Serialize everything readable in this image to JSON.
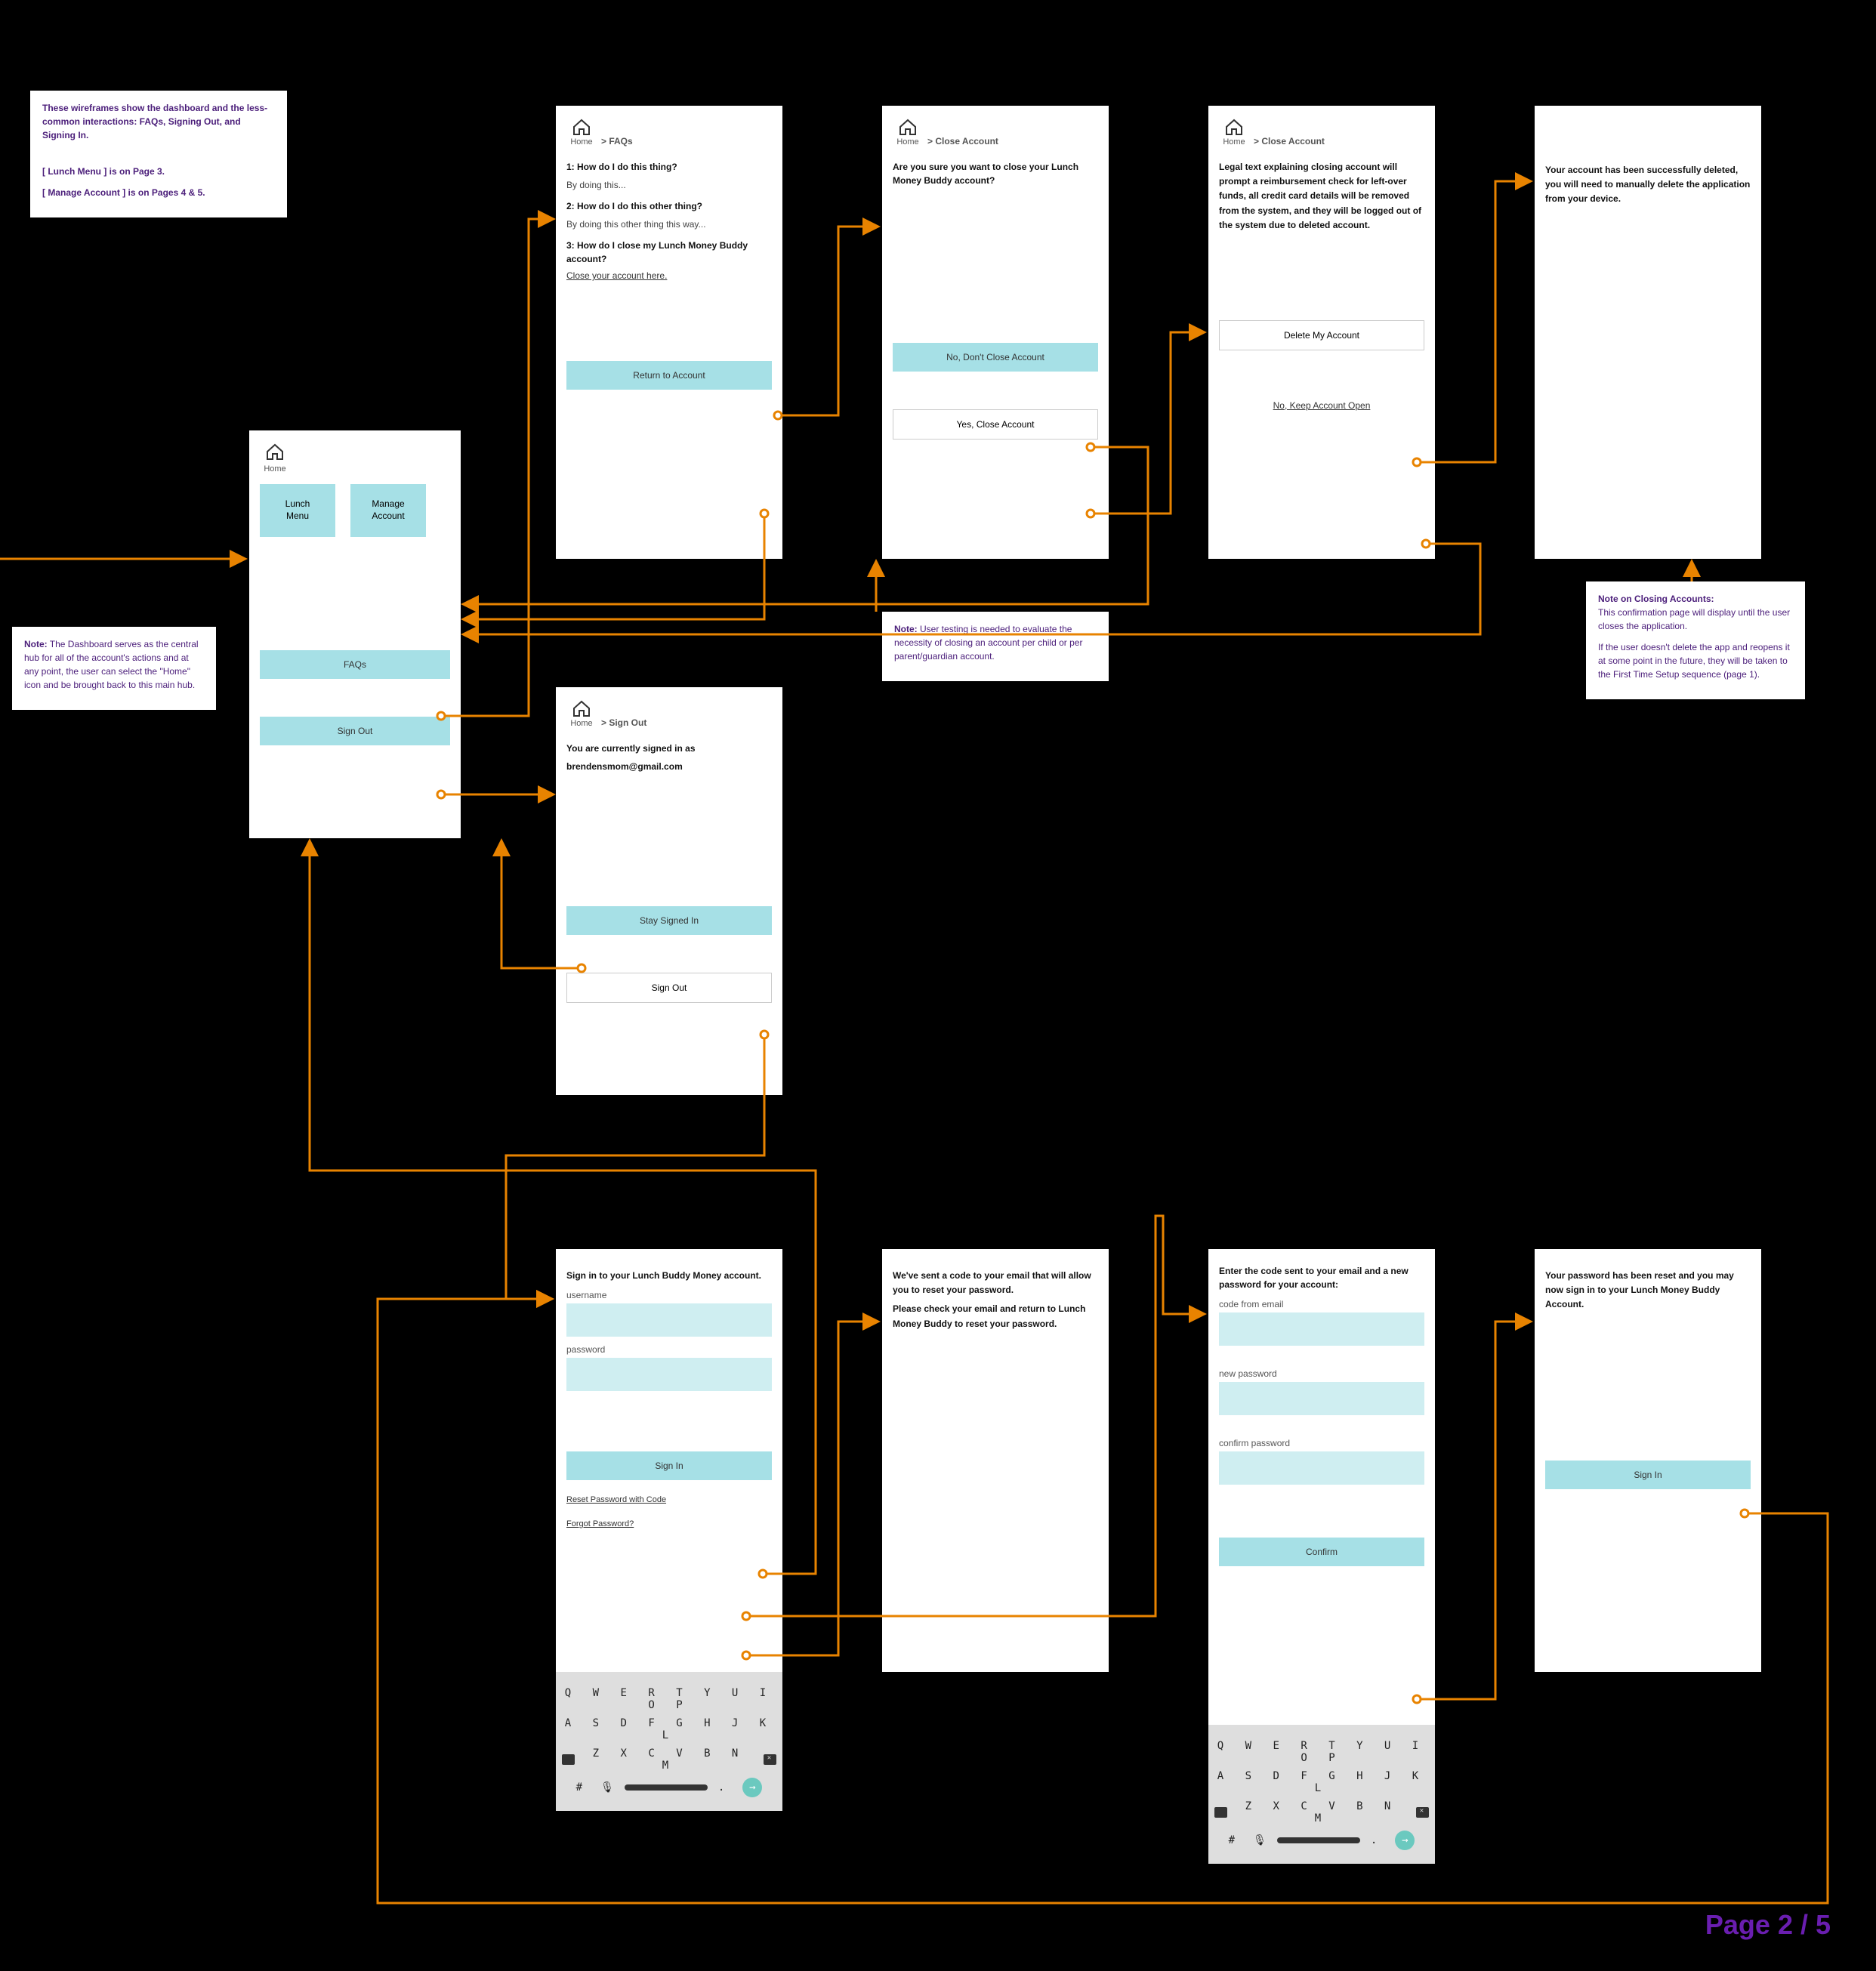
{
  "page_label": "Page 2 / 5",
  "note_intro": {
    "line1": "These wireframes show the dashboard and the less-common interactions: FAQs, Signing Out, and Signing In.",
    "line2": "[ Lunch Menu ] is on Page 3.",
    "line3": "[ Manage Account ] is on Pages 4 & 5."
  },
  "note_dashboard": {
    "label": "Note:",
    "text": "The Dashboard serves as the central hub for all of the account's actions and at any point, the user can select the \"Home\" icon and be brought back to this main hub."
  },
  "note_usertesting": {
    "label": "Note:",
    "text": "User testing is needed to evaluate the necessity of closing an account per child or per parent/guardian account."
  },
  "note_closing": {
    "title": "Note on Closing Accounts:",
    "p1": "This confirmation page will display until the user closes the application.",
    "p2": "If the user doesn't delete the app and reopens it at some point in the future, they will be taken to the First Time Setup sequence (page 1)."
  },
  "dashboard": {
    "home_label": "Home",
    "tile_lunch": "Lunch\nMenu",
    "tile_manage": "Manage\nAccount",
    "btn_faqs": "FAQs",
    "btn_signout": "Sign Out"
  },
  "faqs": {
    "crumb": "> FAQs",
    "q1": "1: How do I do this thing?",
    "a1": "By doing this...",
    "q2": "2: How do I do this other thing?",
    "a2": "By doing this other thing this way...",
    "q3": "3: How do I close my Lunch Money Buddy account?",
    "a3_link": "Close your account here.",
    "btn_return": "Return to Account"
  },
  "close_confirm": {
    "crumb": "> Close Account",
    "prompt": "Are you sure you want to close your Lunch Money Buddy account?",
    "btn_no": "No, Don't Close Account",
    "btn_yes": "Yes, Close Account"
  },
  "close_legal": {
    "crumb": "> Close Account",
    "text": "Legal text explaining closing account will prompt a reimbursement check for left-over funds, all credit card details will be removed from the system, and they will be logged out of the system due to deleted account.",
    "btn_delete": "Delete My Account",
    "link_keep": "No, Keep Account Open"
  },
  "close_done": {
    "text": "Your account has been successfully deleted, you will need to manually delete the application from your device."
  },
  "signout": {
    "crumb": "> Sign Out",
    "line1": "You are currently signed in as",
    "email": "brendensmom@gmail.com",
    "btn_stay": "Stay Signed In",
    "btn_out": "Sign Out"
  },
  "signin": {
    "title": "Sign in to your Lunch Buddy Money account.",
    "lbl_user": "username",
    "lbl_pass": "password",
    "btn_signin": "Sign In",
    "link_reset": "Reset Password with Code",
    "link_forgot": "Forgot Password?"
  },
  "code_sent": {
    "p1": "We've sent a code to your email that will allow you to reset your password.",
    "p2": "Please check your email and return to Lunch Money Buddy to reset your password."
  },
  "new_password": {
    "title": "Enter the code sent to your email and a new password for your account:",
    "lbl_code": "code from email",
    "lbl_new": "new password",
    "lbl_confirm": "confirm password",
    "btn_confirm": "Confirm"
  },
  "reset_done": {
    "text": "Your password has been reset and you may now sign in to your Lunch Money Buddy Account.",
    "btn_signin": "Sign In"
  },
  "keyboard": {
    "row1": "Q W E R T Y U I O P",
    "row2": "A S D F G H J K L",
    "row3": "Z X C V B N M",
    "hash": "#",
    "dot": "."
  }
}
